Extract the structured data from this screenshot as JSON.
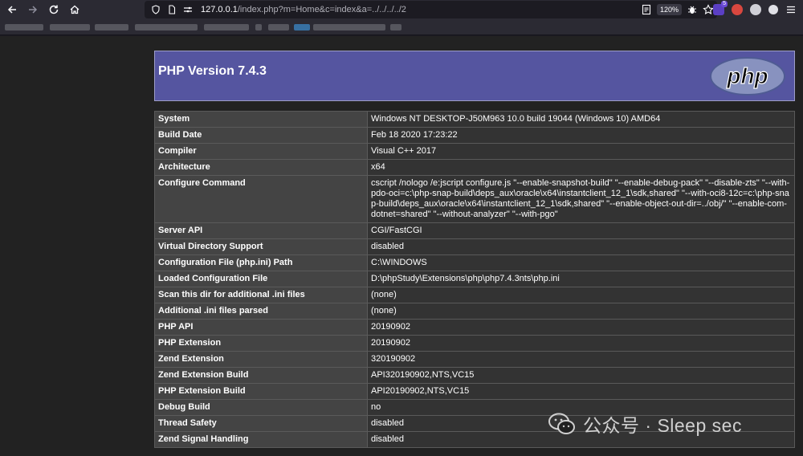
{
  "browser": {
    "url_host": "127.0.0.1",
    "url_path": "/index.php?m=Home&c=index&a=../../../../2",
    "zoom": "120%",
    "ext_badge": "5"
  },
  "header": {
    "title": "PHP Version 7.4.3",
    "logo_text": "php"
  },
  "rows": [
    {
      "key": "System",
      "value": "Windows NT DESKTOP-J50M963 10.0 build 19044 (Windows 10) AMD64"
    },
    {
      "key": "Build Date",
      "value": "Feb 18 2020 17:23:22"
    },
    {
      "key": "Compiler",
      "value": "Visual C++ 2017"
    },
    {
      "key": "Architecture",
      "value": "x64"
    },
    {
      "key": "Configure Command",
      "value": "cscript /nologo /e:jscript configure.js \"--enable-snapshot-build\" \"--enable-debug-pack\" \"--disable-zts\" \"--with-pdo-oci=c:\\php-snap-build\\deps_aux\\oracle\\x64\\instantclient_12_1\\sdk,shared\" \"--with-oci8-12c=c:\\php-snap-build\\deps_aux\\oracle\\x64\\instantclient_12_1\\sdk,shared\" \"--enable-object-out-dir=../obj/\" \"--enable-com-dotnet=shared\" \"--without-analyzer\" \"--with-pgo\""
    },
    {
      "key": "Server API",
      "value": "CGI/FastCGI"
    },
    {
      "key": "Virtual Directory Support",
      "value": "disabled"
    },
    {
      "key": "Configuration File (php.ini) Path",
      "value": "C:\\WINDOWS"
    },
    {
      "key": "Loaded Configuration File",
      "value": "D:\\phpStudy\\Extensions\\php\\php7.4.3nts\\php.ini"
    },
    {
      "key": "Scan this dir for additional .ini files",
      "value": "(none)"
    },
    {
      "key": "Additional .ini files parsed",
      "value": "(none)"
    },
    {
      "key": "PHP API",
      "value": "20190902"
    },
    {
      "key": "PHP Extension",
      "value": "20190902"
    },
    {
      "key": "Zend Extension",
      "value": "320190902"
    },
    {
      "key": "Zend Extension Build",
      "value": "API320190902,NTS,VC15"
    },
    {
      "key": "PHP Extension Build",
      "value": "API20190902,NTS,VC15"
    },
    {
      "key": "Debug Build",
      "value": "no"
    },
    {
      "key": "Thread Safety",
      "value": "disabled"
    },
    {
      "key": "Zend Signal Handling",
      "value": "disabled"
    }
  ],
  "watermark": {
    "text": "公众号 · Sleep sec"
  }
}
